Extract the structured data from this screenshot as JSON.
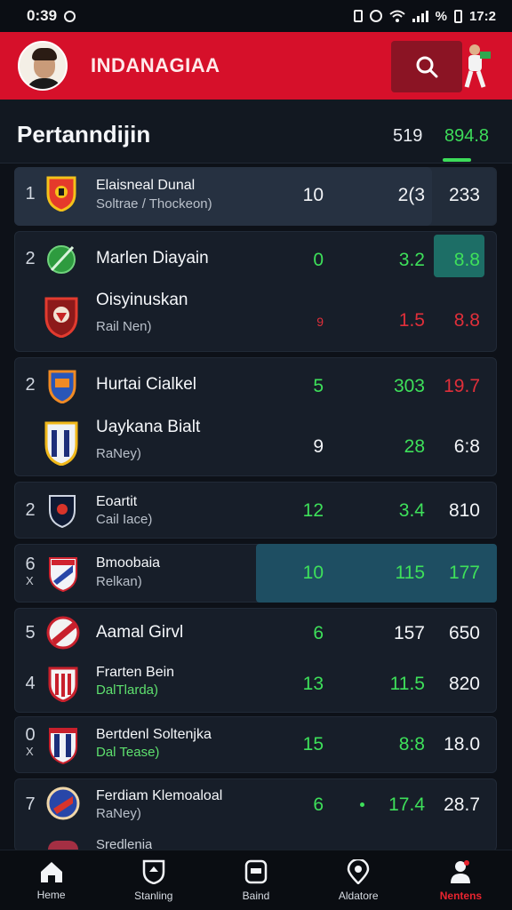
{
  "status": {
    "time": "0:39",
    "right_text": "17:2",
    "battery": "%"
  },
  "header": {
    "title": "INDANAGIAA"
  },
  "section": {
    "title": "Pertanndijin",
    "tab_a": "519",
    "tab_b": "894.8"
  },
  "rows": [
    {
      "rank": "1",
      "name": "Elaisneal Dunal",
      "sub": "Soltrae / Thockeon)",
      "c1": "10",
      "c2": "2(3",
      "c3": "233"
    },
    {
      "rank": "2",
      "name": "Marlen Diayain",
      "c1": "0",
      "c2": "3.2",
      "c3": "8.8"
    },
    {
      "name": "Oisyinuskan",
      "sub": "Rail Nen)",
      "c1": "9",
      "c2": "1.5",
      "c3": "8.8"
    },
    {
      "rank": "2",
      "name": "Hurtai Cialkel",
      "c1": "5",
      "c2": "303",
      "c3": "19.7"
    },
    {
      "name": "Uaykana Bialt",
      "sub": "RaNey)",
      "c1": "9",
      "c2": "28",
      "c3": "6:8"
    },
    {
      "rank": "2",
      "name": "Eoartit",
      "sub": "Cail Iace)",
      "c1": "12",
      "c2": "3.4",
      "c3": "810"
    },
    {
      "rank": "6",
      "rank_sub": "X",
      "name": "Bmoobaia",
      "sub": "Relkan)",
      "c1": "10",
      "c2": "115",
      "c3": "177"
    },
    {
      "rank": "5",
      "name": "Aamal Girvl",
      "c1": "6",
      "c2": "157",
      "c3": "650"
    },
    {
      "rank": "4",
      "name": "Frarten Bein",
      "sub": "DalTlarda)",
      "c1": "13",
      "c2": "11.5",
      "c3": "820"
    },
    {
      "rank": "0",
      "rank_sub": "X",
      "name": "Bertdenl Soltenjka",
      "sub": "Dal Tease)",
      "c1": "15",
      "c2": "8:8",
      "c3": "18.0"
    },
    {
      "rank": "7",
      "name": "Ferdiam Klemoaloal",
      "sub": "RaNey)",
      "c1": "6",
      "c2": "17.4",
      "c3": "28.7"
    }
  ],
  "peek_text": "Sredlenia",
  "nav": [
    {
      "label": "Heme",
      "icon": "home-icon"
    },
    {
      "label": "Stanling",
      "icon": "shield-icon"
    },
    {
      "label": "Baind",
      "icon": "board-icon"
    },
    {
      "label": "Aldatore",
      "icon": "location-icon"
    },
    {
      "label": "Nentens",
      "icon": "profile-icon",
      "active": true
    }
  ],
  "colors": {
    "brand_red": "#d6102a",
    "accent_green": "#3ddc5a",
    "negative_red": "#e02f3a",
    "background": "#0d1118"
  }
}
